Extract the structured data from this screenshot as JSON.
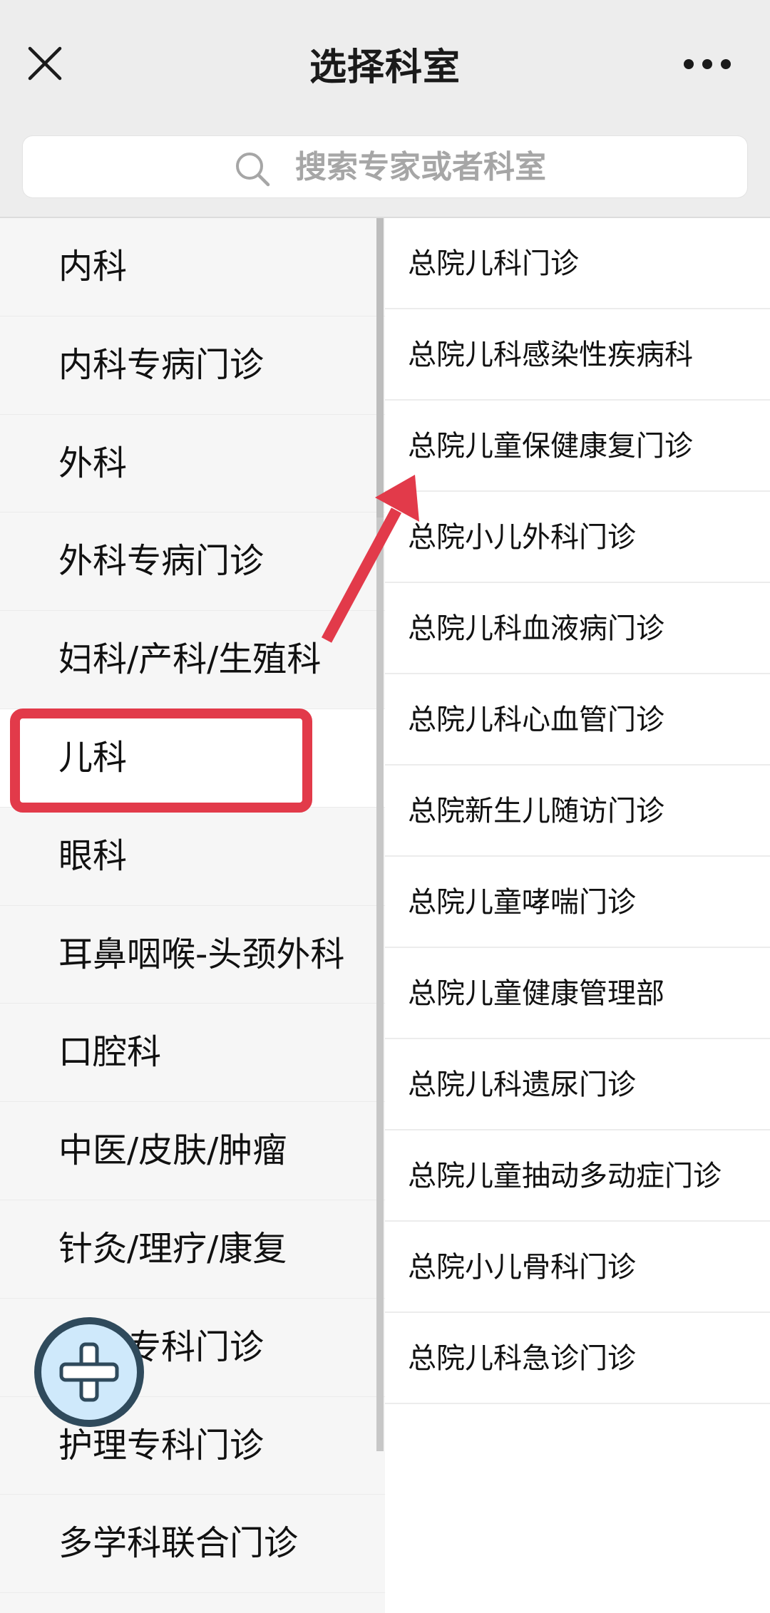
{
  "header": {
    "title": "选择科室",
    "close_icon": "close-icon",
    "more_icon": "more-dots-icon"
  },
  "search": {
    "placeholder": "搜索专家或者科室",
    "icon": "search-icon"
  },
  "departments": [
    {
      "label": "内科"
    },
    {
      "label": "内科专病门诊"
    },
    {
      "label": "外科"
    },
    {
      "label": "外科专病门诊"
    },
    {
      "label": "妇科/产科/生殖科"
    },
    {
      "label": "儿科",
      "selected": true
    },
    {
      "label": "眼科"
    },
    {
      "label": "耳鼻咽喉-头颈外科"
    },
    {
      "label": "口腔科"
    },
    {
      "label": "中医/皮肤/肿瘤"
    },
    {
      "label": "针灸/理疗/康复"
    },
    {
      "label": "专科门诊"
    },
    {
      "label": "护理专科门诊"
    },
    {
      "label": "多学科联合门诊"
    }
  ],
  "sub_departments": [
    {
      "label": "总院儿科门诊"
    },
    {
      "label": "总院儿科感染性疾病科"
    },
    {
      "label": "总院儿童保健康复门诊"
    },
    {
      "label": "总院小儿外科门诊"
    },
    {
      "label": "总院儿科血液病门诊"
    },
    {
      "label": "总院儿科心血管门诊"
    },
    {
      "label": "总院新生儿随访门诊"
    },
    {
      "label": "总院儿童哮喘门诊"
    },
    {
      "label": "总院儿童健康管理部"
    },
    {
      "label": "总院儿科遗尿门诊"
    },
    {
      "label": "总院儿童抽动多动症门诊"
    },
    {
      "label": "总院小儿骨科门诊"
    },
    {
      "label": "总院儿科急诊门诊"
    }
  ],
  "annotation": {
    "color": "#e23a4a",
    "arrow_icon": "arrow-icon",
    "highlight": "儿科"
  },
  "fab": {
    "icon": "plus-icon",
    "color": "#cfe9fb"
  }
}
